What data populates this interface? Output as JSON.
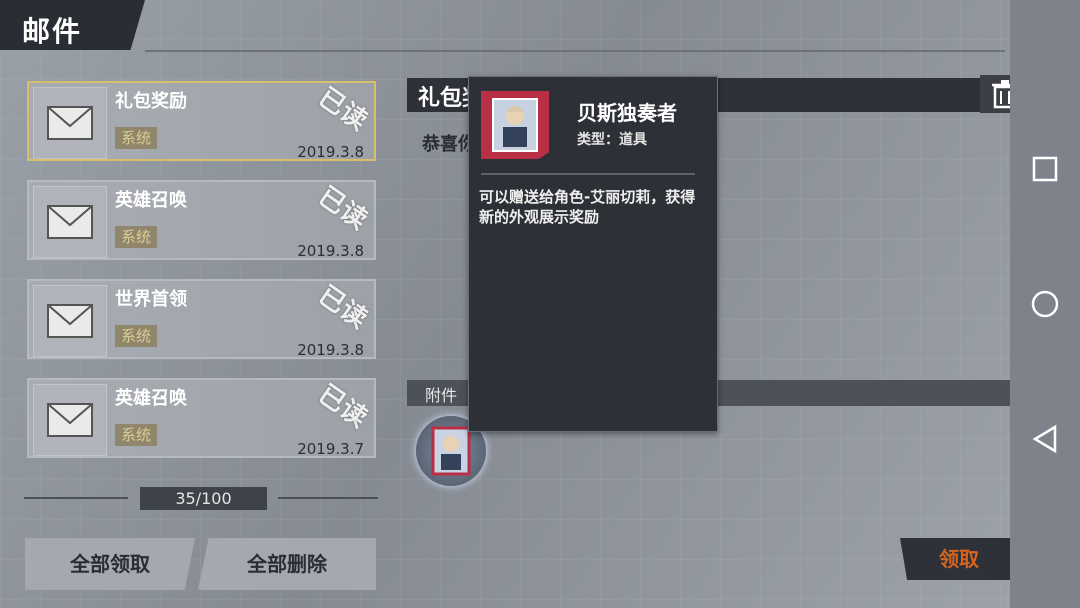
{
  "header": {
    "title": "邮件"
  },
  "mail_list": [
    {
      "title": "礼包奖励",
      "tag": "系统",
      "date": "2019.3.8",
      "stamp": "已读",
      "selected": true
    },
    {
      "title": "英雄召唤",
      "tag": "系统",
      "date": "2019.3.8",
      "stamp": "已读",
      "selected": false
    },
    {
      "title": "世界首领",
      "tag": "系统",
      "date": "2019.3.8",
      "stamp": "已读",
      "selected": false
    },
    {
      "title": "英雄召唤",
      "tag": "系统",
      "date": "2019.3.7",
      "stamp": "已读",
      "selected": false
    }
  ],
  "pager": {
    "count": "35/100"
  },
  "actions": {
    "claim_all": "全部领取",
    "delete_all": "全部删除",
    "claim": "领取"
  },
  "detail": {
    "title": "礼包奖励",
    "body": "恭喜你",
    "attachments_label": "附件"
  },
  "popup": {
    "name": "贝斯独奏者",
    "type": "类型：道具",
    "desc": "可以赠送给角色-艾丽切莉，获得新的外观展示奖励"
  },
  "colors": {
    "accent": "#d5641e",
    "tag_bg": "#8f866b",
    "card_red": "#b92f46"
  },
  "icons": [
    "close-icon",
    "envelope-icon",
    "trash-icon",
    "square-nav-icon",
    "circle-nav-icon",
    "back-nav-icon"
  ]
}
